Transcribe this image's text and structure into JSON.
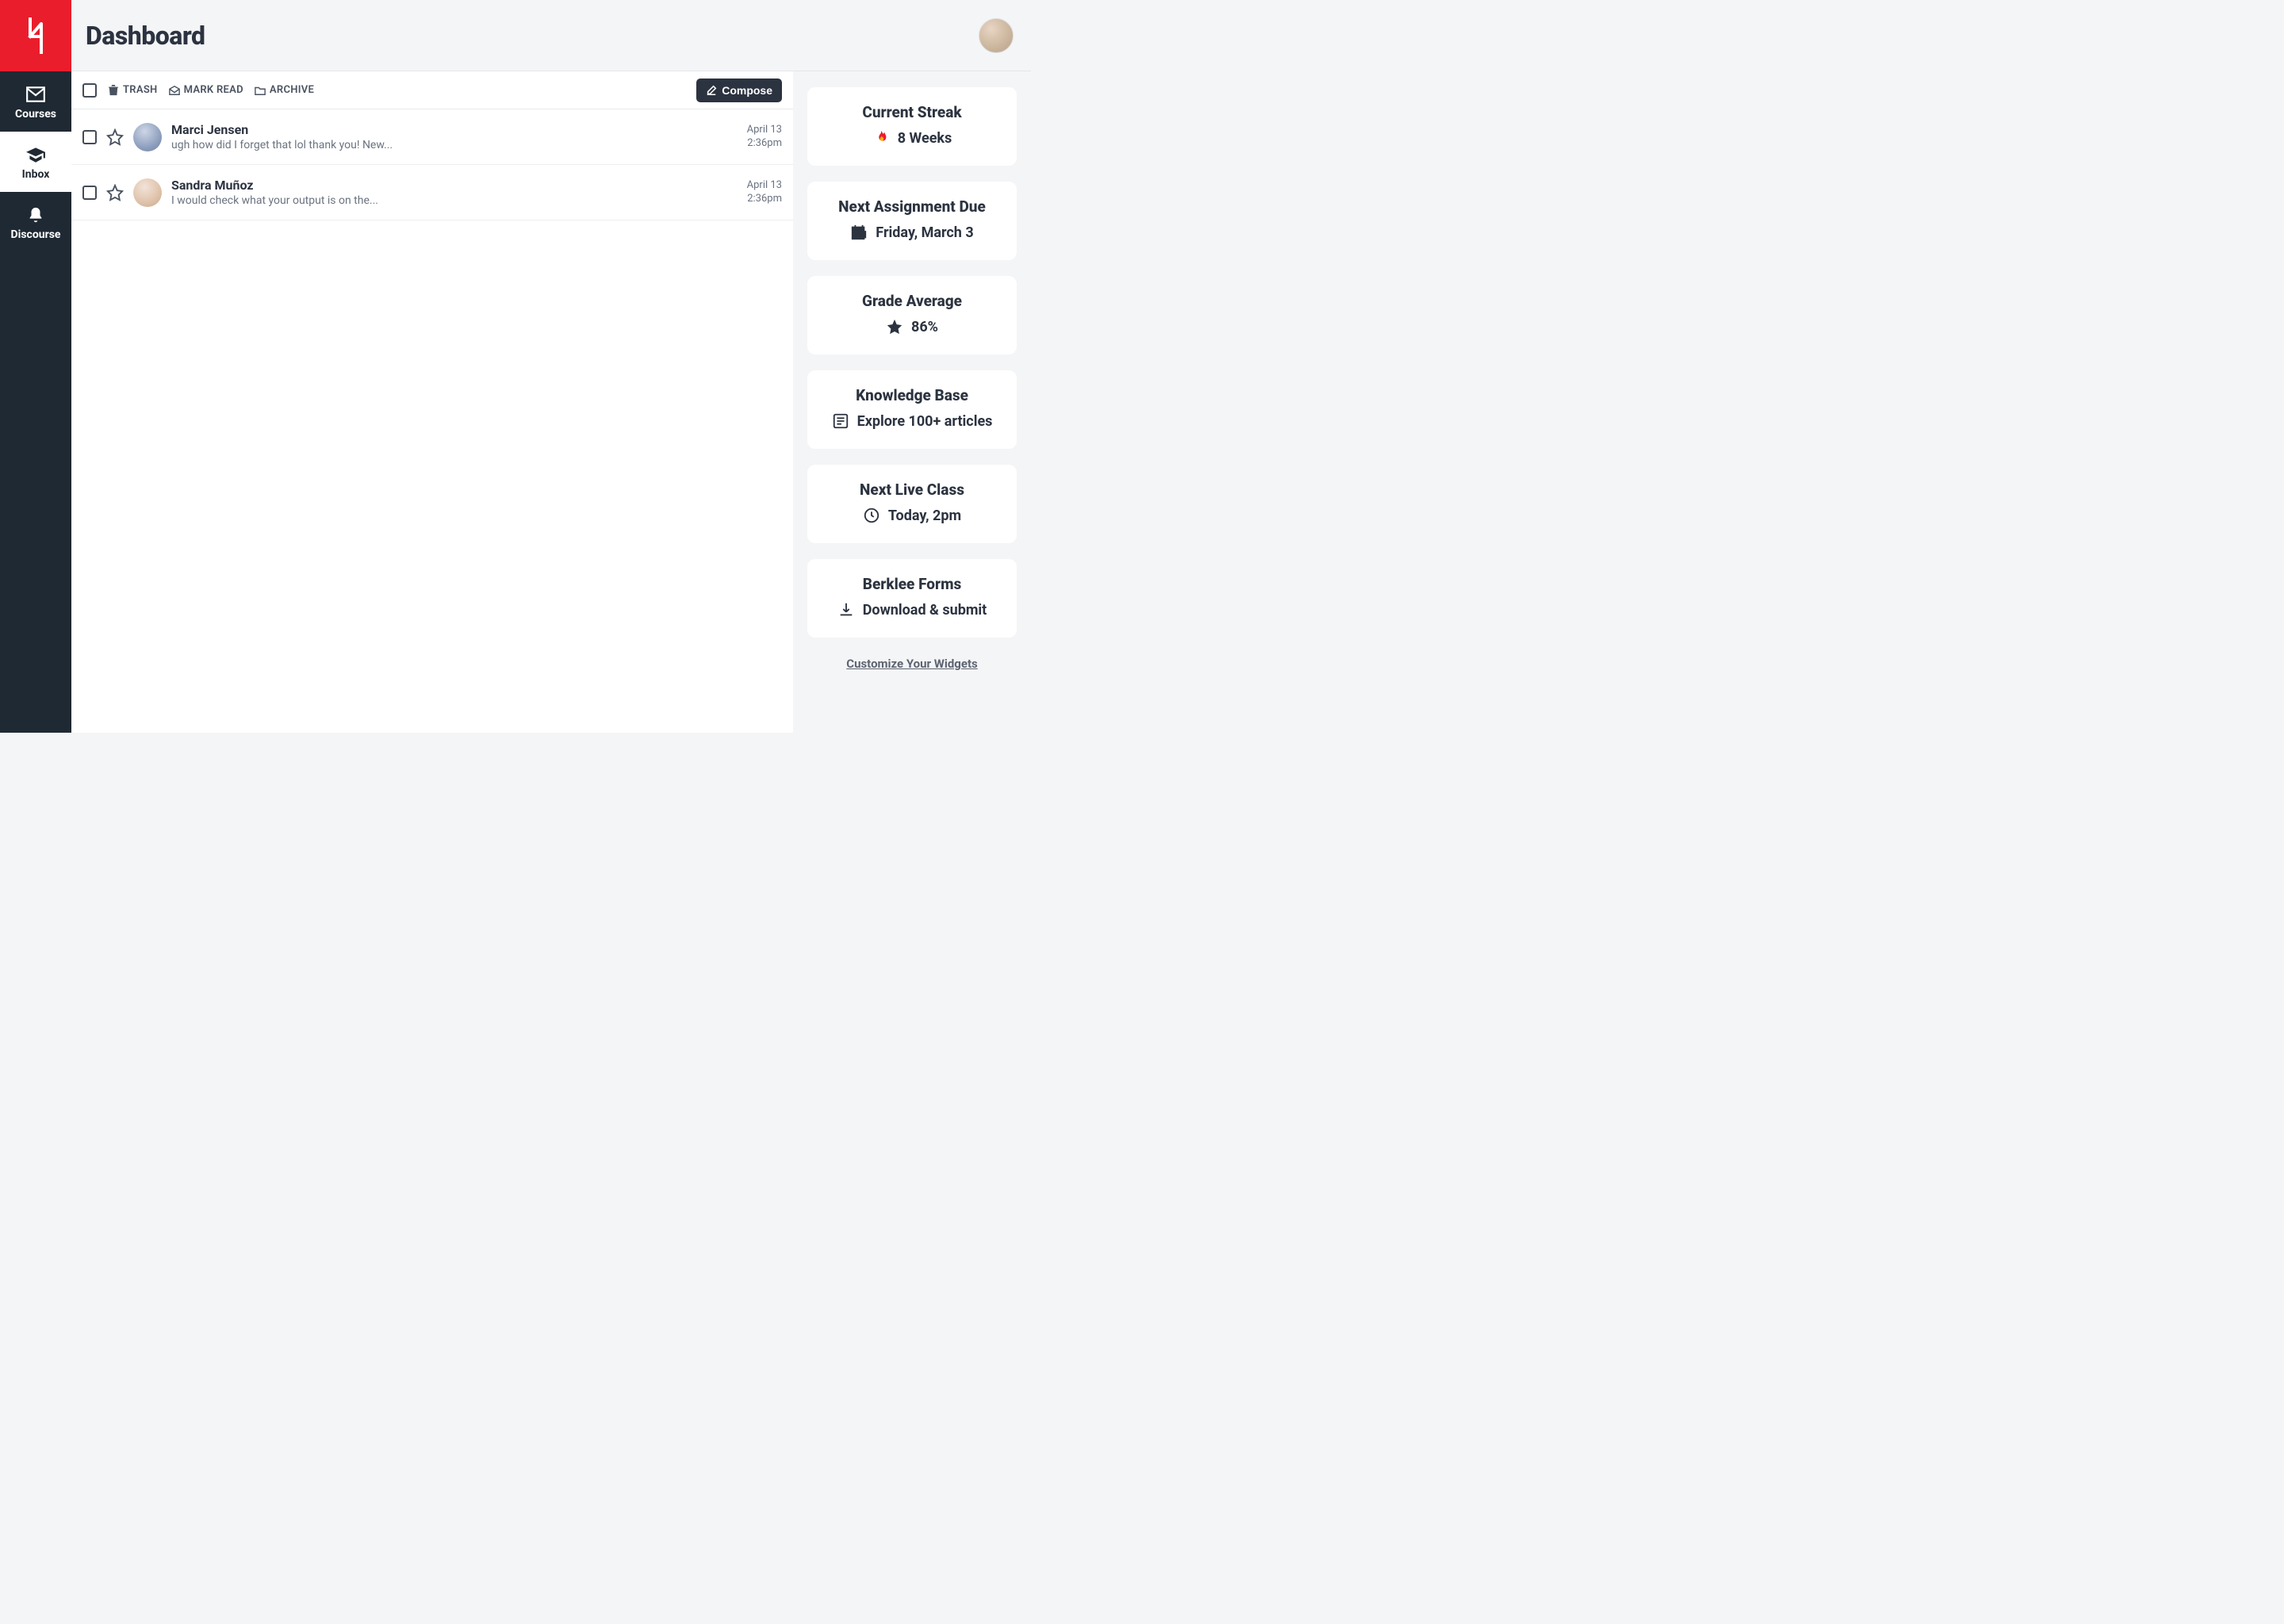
{
  "header": {
    "title": "Dashboard"
  },
  "sidebar": {
    "items": [
      {
        "label": "Courses"
      },
      {
        "label": "Inbox"
      },
      {
        "label": "Discourse"
      }
    ]
  },
  "toolbar": {
    "trash_label": "TRASH",
    "mark_read_label": "MARK READ",
    "archive_label": "ARCHIVE",
    "compose_label": "Compose"
  },
  "messages": [
    {
      "sender": "Marci Jensen",
      "preview": "ugh how did I forget that lol thank you! New...",
      "date": "April 13",
      "time": "2:36pm"
    },
    {
      "sender": "Sandra Muñoz",
      "preview": "I would check what your output is on the...",
      "date": "April 13",
      "time": "2:36pm"
    }
  ],
  "widgets": [
    {
      "title": "Current Streak",
      "value": "8 Weeks",
      "icon": "fire"
    },
    {
      "title": "Next Assignment Due",
      "value": "Friday, March 3",
      "icon": "calendar"
    },
    {
      "title": "Grade Average",
      "value": "86%",
      "icon": "star"
    },
    {
      "title": "Knowledge Base",
      "value": "Explore 100+ articles",
      "icon": "article"
    },
    {
      "title": "Next Live Class",
      "value": "Today, 2pm",
      "icon": "clock"
    },
    {
      "title": "Berklee Forms",
      "value": "Download & submit",
      "icon": "download"
    }
  ],
  "customize_label": "Customize Your Widgets"
}
